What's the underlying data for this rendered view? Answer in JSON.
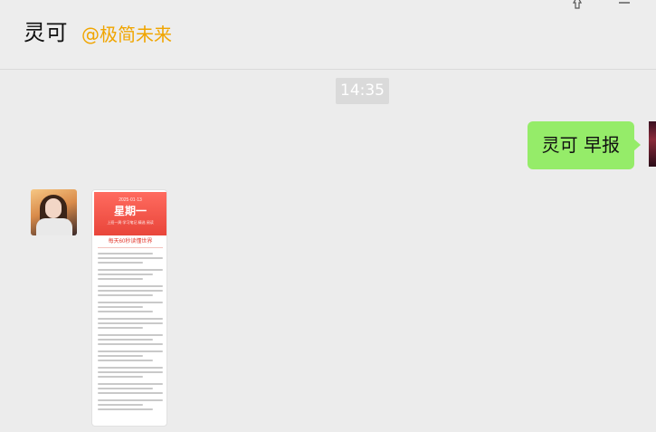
{
  "header": {
    "title": "灵可",
    "subtitle": "@极简未来",
    "icons": [
      "pin-icon",
      "menu-icon"
    ]
  },
  "chat": {
    "timestamp": "14:35",
    "messages": [
      {
        "side": "right",
        "text": "灵可 早报"
      },
      {
        "side": "left",
        "type": "image",
        "banner_small": "2025·01·13",
        "banner_big": "星期一",
        "banner_sub": "上班一周·学习笔记 精选 阅读",
        "heading": "每天60秒读懂世界"
      }
    ]
  },
  "colors": {
    "subtitle": "#f0a500",
    "bubble_right": "#95ec69",
    "timestamp_bg": "#dadada"
  }
}
